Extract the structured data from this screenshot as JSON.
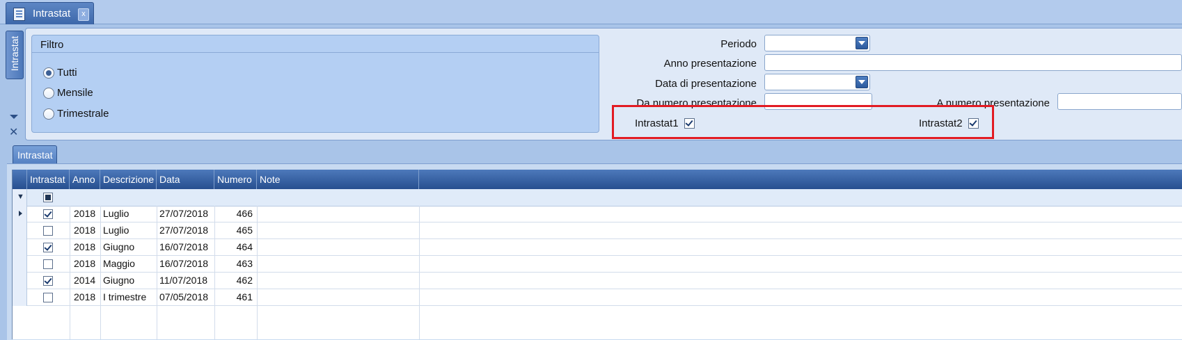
{
  "window": {
    "doc_tab_title": "Intrastat",
    "doc_tab_close": "x",
    "side_tab_label": "Intrastat"
  },
  "filter": {
    "group_title": "Filtro",
    "radios": [
      {
        "label": "Tutti",
        "selected": true
      },
      {
        "label": "Mensile",
        "selected": false
      },
      {
        "label": "Trimestrale",
        "selected": false
      }
    ],
    "fields": {
      "periodo_label": "Periodo",
      "periodo_value": "",
      "anno_label": "Anno presentazione",
      "anno_value": "",
      "data_label": "Data di presentazione",
      "data_value": "",
      "da_numero_label": "Da numero presentazione",
      "da_numero_value": "",
      "a_numero_label": "A numero presentazione",
      "a_numero_value": ""
    },
    "checks": {
      "intrastat1_label": "Intrastat1",
      "intrastat1_checked": true,
      "intrastat2_label": "Intrastat2",
      "intrastat2_checked": true
    }
  },
  "grid": {
    "tab_label": "Intrastat",
    "columns": [
      "Intrastat",
      "Anno",
      "Descrizione",
      "Data",
      "Numero",
      "Note"
    ],
    "rows": [
      {
        "intrastat": true,
        "anno": "2018",
        "descrizione": "Luglio",
        "data": "27/07/2018",
        "numero": "466",
        "note": ""
      },
      {
        "intrastat": false,
        "anno": "2018",
        "descrizione": "Luglio",
        "data": "27/07/2018",
        "numero": "465",
        "note": ""
      },
      {
        "intrastat": true,
        "anno": "2018",
        "descrizione": "Giugno",
        "data": "16/07/2018",
        "numero": "464",
        "note": ""
      },
      {
        "intrastat": false,
        "anno": "2018",
        "descrizione": "Maggio",
        "data": "16/07/2018",
        "numero": "463",
        "note": ""
      },
      {
        "intrastat": true,
        "anno": "2014",
        "descrizione": "Giugno",
        "data": "11/07/2018",
        "numero": "462",
        "note": ""
      },
      {
        "intrastat": false,
        "anno": "2018",
        "descrizione": "I trimestre",
        "data": "07/05/2018",
        "numero": "461",
        "note": ""
      }
    ]
  },
  "colors": {
    "highlight": "#e21b23",
    "header_blue": "#274f8f",
    "background": "#a9c4e8"
  }
}
